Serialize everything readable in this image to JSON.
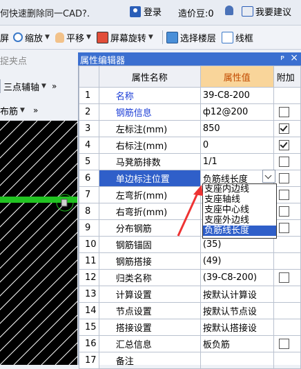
{
  "topbar": {
    "help_text": "何快速删除同一CAD?.",
    "login_label": "登录",
    "points_label": "造价豆:0",
    "suggest_label": "我要建议"
  },
  "toolbar": {
    "items": [
      {
        "label": "屏",
        "icon": "screen-icon"
      },
      {
        "label": "缩放",
        "icon": "zoom-icon"
      },
      {
        "label": "平移",
        "icon": "pan-hand-icon"
      },
      {
        "label": "屏幕旋转",
        "icon": "rotate-screen-icon"
      },
      {
        "label": "选择楼层",
        "icon": "floor-select-icon"
      },
      {
        "label": "线框",
        "icon": "wireframe-icon"
      }
    ]
  },
  "left": {
    "row1": "捉夹点",
    "row2": "三点辅轴",
    "row3": "布筋"
  },
  "panel": {
    "title": "属性编辑器",
    "pin": "ᴘ",
    "close": "×",
    "headers": [
      "",
      "属性名称",
      "属性值",
      "附加"
    ],
    "rows": [
      {
        "num": "1",
        "name": "名称",
        "value": "39-C8-200",
        "blue": true,
        "check": null
      },
      {
        "num": "2",
        "name": "钢筋信息",
        "value": "ф12@200",
        "blue": true,
        "check": false
      },
      {
        "num": "3",
        "name": "左标注(mm)",
        "value": "850",
        "blue": false,
        "check": true
      },
      {
        "num": "4",
        "name": "右标注(mm)",
        "value": "0",
        "blue": false,
        "check": true
      },
      {
        "num": "5",
        "name": "马凳筋排数",
        "value": "1/1",
        "blue": false,
        "check": false
      },
      {
        "num": "6",
        "name": "单边标注位置",
        "value": "负筋线长度",
        "blue": false,
        "check": false,
        "selected": true
      },
      {
        "num": "7",
        "name": "左弯折(mm)",
        "value": "",
        "blue": false,
        "check": false
      },
      {
        "num": "8",
        "name": "右弯折(mm)",
        "value": "",
        "blue": false,
        "check": false
      },
      {
        "num": "9",
        "name": "分布钢筋",
        "value": "",
        "blue": false,
        "check": false
      },
      {
        "num": "10",
        "name": "钢筋锚固",
        "value": "(35)",
        "blue": false,
        "check": null
      },
      {
        "num": "11",
        "name": "钢筋搭接",
        "value": "(49)",
        "blue": false,
        "check": null
      },
      {
        "num": "12",
        "name": "归类名称",
        "value": "(39-C8-200)",
        "blue": false,
        "check": false
      },
      {
        "num": "13",
        "name": "计算设置",
        "value": "按默认计算设",
        "blue": false,
        "check": null
      },
      {
        "num": "14",
        "name": "节点设置",
        "value": "按默认节点设",
        "blue": false,
        "check": null
      },
      {
        "num": "15",
        "name": "搭接设置",
        "value": "按默认搭接设",
        "blue": false,
        "check": null
      },
      {
        "num": "16",
        "name": "汇总信息",
        "value": "板负筋",
        "blue": false,
        "check": false
      },
      {
        "num": "17",
        "name": "备注",
        "value": "",
        "blue": false,
        "check": null
      }
    ],
    "dropdown_options": [
      "支座内边线",
      "支座轴线",
      "支座中心线",
      "支座外边线",
      "负筋线长度"
    ],
    "dropdown_selected_index": 4
  },
  "colors": {
    "panel_title_bg": "#3b6fd0",
    "selection": "#2f5fc9",
    "value_header_bg": "#f9d59a",
    "name_blue": "#1a3cd6",
    "canvas_bg": "#000000",
    "canvas_lines": "#ffffff",
    "green_line": "#22c322",
    "annotation_arrow": "#ee3333"
  }
}
